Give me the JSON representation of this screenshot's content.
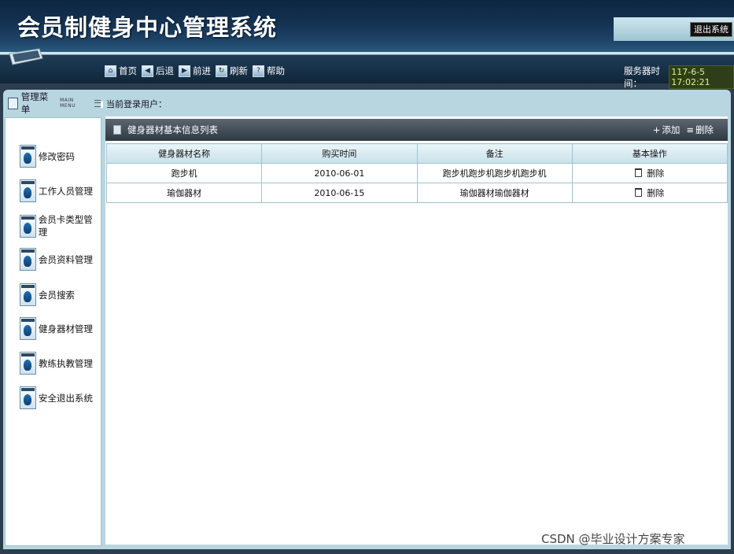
{
  "header": {
    "title": "会员制健身中心管理系统",
    "logout_label": "退出系统"
  },
  "nav": {
    "items": [
      {
        "label": "首页",
        "icon": "home-icon"
      },
      {
        "label": "后退",
        "icon": "back-arrow-icon"
      },
      {
        "label": "前进",
        "icon": "forward-arrow-icon"
      },
      {
        "label": "刷新",
        "icon": "refresh-icon"
      },
      {
        "label": "帮助",
        "icon": "help-icon"
      }
    ],
    "server_time_label": "服务器时间：",
    "server_time_value": "117-6-5 17:02:21"
  },
  "menu": {
    "title": "管理菜单",
    "title_en": "MAIN MENU",
    "user_label": "当前登录用户：",
    "items": [
      {
        "label": "修改密码"
      },
      {
        "label": "工作人员管理"
      },
      {
        "label": "会员卡类型管理"
      },
      {
        "label": "会员资料管理"
      },
      {
        "label": "会员搜索"
      },
      {
        "label": "健身器材管理"
      },
      {
        "label": "教练执教管理"
      },
      {
        "label": "安全退出系统"
      }
    ]
  },
  "content": {
    "heading": "健身器材基本信息列表",
    "add_label": "添加",
    "delete_label": "删除",
    "columns": [
      "健身器材名称",
      "购买时间",
      "备注",
      "基本操作"
    ],
    "rows": [
      {
        "name": "跑步机",
        "date": "2010-06-01",
        "note": "跑步机跑步机跑步机跑步机",
        "action": "删除"
      },
      {
        "name": "瑜伽器材",
        "date": "2010-06-15",
        "note": "瑜伽器材瑜伽器材",
        "action": "删除"
      }
    ]
  },
  "watermark": "CSDN @毕业设计方案专家"
}
